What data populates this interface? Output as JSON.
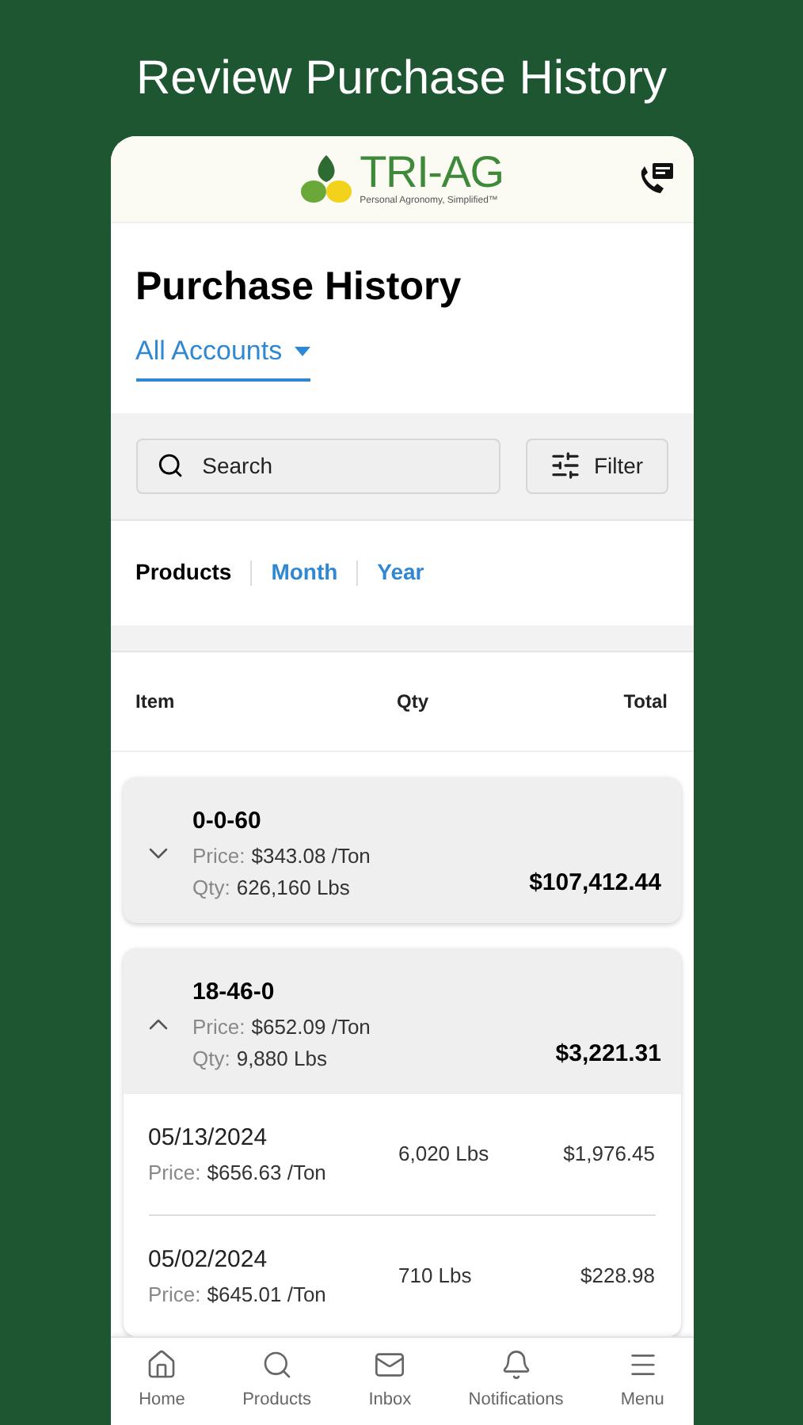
{
  "headline": "Review Purchase History",
  "header": {
    "logo_text": "TRI-AG",
    "tagline": "Personal Agronomy, Simplified™"
  },
  "page_title": "Purchase History",
  "account_selector": {
    "value": "All Accounts"
  },
  "search": {
    "placeholder": "Search"
  },
  "filter_button": "Filter",
  "tabs": [
    {
      "label": "Products",
      "selected": true
    },
    {
      "label": "Month",
      "selected": false
    },
    {
      "label": "Year",
      "selected": false
    }
  ],
  "columns": [
    "Item",
    "Qty",
    "Total"
  ],
  "products": [
    {
      "name": "0-0-60",
      "price_label": "Price:",
      "price": "$343.08 /Ton",
      "qty_label": "Qty:",
      "qty": "626,160 Lbs",
      "total": "$107,412.44",
      "expanded": false
    },
    {
      "name": "18-46-0",
      "price_label": "Price:",
      "price": "$652.09 /Ton",
      "qty_label": "Qty:",
      "qty": "9,880 Lbs",
      "total": "$3,221.31",
      "expanded": true,
      "purchases": [
        {
          "date": "05/13/2024",
          "price_label": "Price:",
          "price": "$656.63 /Ton",
          "qty": "6,020 Lbs",
          "total": "$1,976.45"
        },
        {
          "date": "05/02/2024",
          "price_label": "Price:",
          "price": "$645.01 /Ton",
          "qty": "710 Lbs",
          "total": "$228.98"
        }
      ]
    }
  ],
  "nav": [
    {
      "label": "Home",
      "kind": "home"
    },
    {
      "label": "Products",
      "kind": "search"
    },
    {
      "label": "Inbox",
      "kind": "mail"
    },
    {
      "label": "Notifications",
      "kind": "bell"
    },
    {
      "label": "Menu",
      "kind": "menu"
    }
  ]
}
